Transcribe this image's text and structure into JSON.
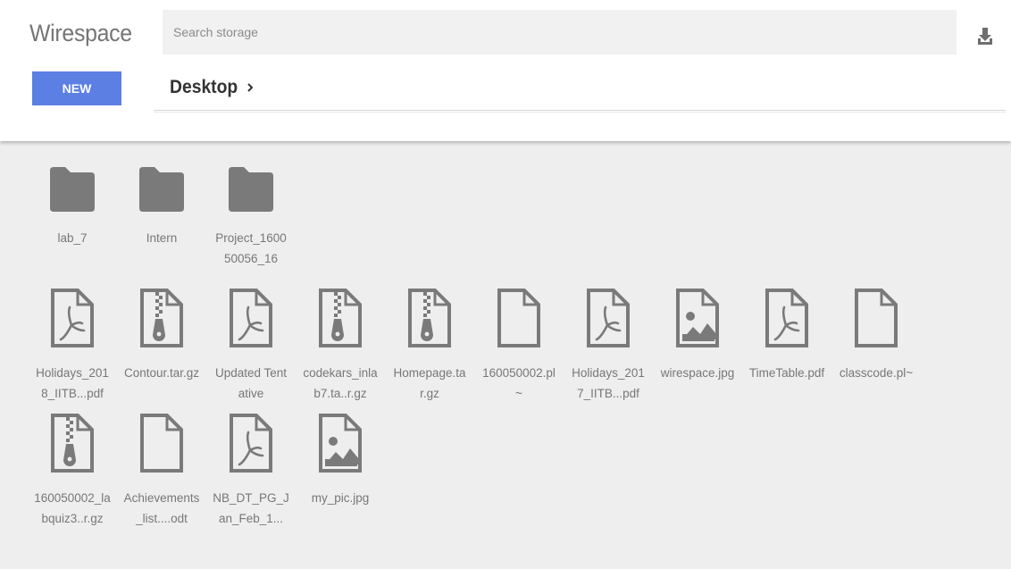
{
  "app": {
    "title": "Wirespace"
  },
  "search": {
    "placeholder": "Search storage",
    "value": ""
  },
  "toolbar": {
    "new_label": "NEW",
    "download_icon": "download-icon"
  },
  "breadcrumb": {
    "current": "Desktop",
    "chevron_icon": "chevron-right-icon"
  },
  "colors": {
    "accent": "#5b7fe3",
    "icon": "#7a7a7a",
    "background": "#eeeeee",
    "header": "#ffffff"
  },
  "items": [
    {
      "type": "folder",
      "icon": "folder-icon",
      "label": "lab_7"
    },
    {
      "type": "folder",
      "icon": "folder-icon",
      "label": "Intern"
    },
    {
      "type": "folder",
      "icon": "folder-icon",
      "label": "Project_160050056_16"
    },
    {
      "type": "pdf",
      "icon": "pdf-file-icon",
      "label": "Holidays_2018_IITB...pdf"
    },
    {
      "type": "archive",
      "icon": "archive-file-icon",
      "label": "Contour.tar.gz"
    },
    {
      "type": "pdf",
      "icon": "pdf-file-icon",
      "label": "Updated Tentative"
    },
    {
      "type": "archive",
      "icon": "archive-file-icon",
      "label": "codekars_inlab7.ta..r.gz"
    },
    {
      "type": "archive",
      "icon": "archive-file-icon",
      "label": "Homepage.tar.gz"
    },
    {
      "type": "file",
      "icon": "file-icon",
      "label": "160050002.pl~"
    },
    {
      "type": "pdf",
      "icon": "pdf-file-icon",
      "label": "Holidays_2017_IITB...pdf"
    },
    {
      "type": "image",
      "icon": "image-file-icon",
      "label": "wirespace.jpg"
    },
    {
      "type": "pdf",
      "icon": "pdf-file-icon",
      "label": "TimeTable.pdf"
    },
    {
      "type": "file",
      "icon": "file-icon",
      "label": "classcode.pl~"
    },
    {
      "type": "archive",
      "icon": "archive-file-icon",
      "label": "160050002_labquiz3..r.gz"
    },
    {
      "type": "file",
      "icon": "file-icon",
      "label": "Achievements_list....odt"
    },
    {
      "type": "pdf",
      "icon": "pdf-file-icon",
      "label": "NB_DT_PG_Jan_Feb_1..."
    },
    {
      "type": "image",
      "icon": "image-file-icon",
      "label": "my_pic.jpg"
    }
  ]
}
